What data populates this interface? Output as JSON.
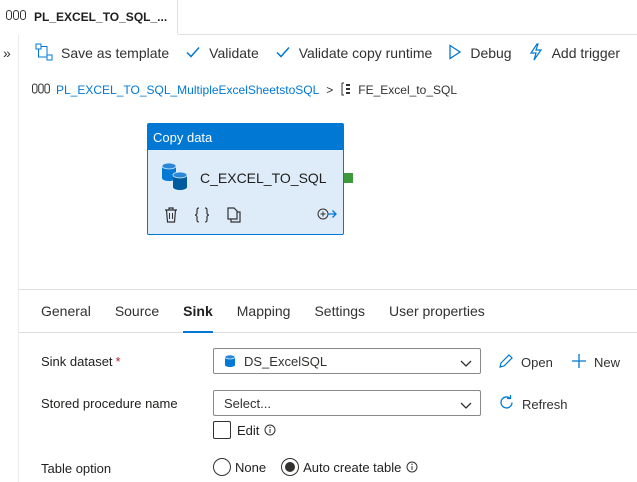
{
  "tab": {
    "label": "PL_EXCEL_TO_SQL_..."
  },
  "toolbar": {
    "save_template": "Save as template",
    "validate": "Validate",
    "validate_copy_runtime": "Validate copy runtime",
    "debug": "Debug",
    "add_trigger": "Add trigger"
  },
  "breadcrumb": {
    "pipeline": "PL_EXCEL_TO_SQL_MultipleExcelSheetstoSQL",
    "separator": ">",
    "current": "FE_Excel_to_SQL"
  },
  "activity": {
    "type": "Copy data",
    "name": "C_EXCEL_TO_SQL"
  },
  "tabs": [
    {
      "label": "General"
    },
    {
      "label": "Source"
    },
    {
      "label": "Sink"
    },
    {
      "label": "Mapping"
    },
    {
      "label": "Settings"
    },
    {
      "label": "User properties"
    }
  ],
  "sink": {
    "dataset_label": "Sink dataset",
    "required_mark": "*",
    "dataset_value": "DS_ExcelSQL",
    "open_label": "Open",
    "new_label": "New",
    "sp_label": "Stored procedure name",
    "sp_placeholder": "Select...",
    "refresh_label": "Refresh",
    "edit_label": "Edit",
    "table_option_label": "Table option",
    "option_none": "None",
    "option_auto": "Auto create table",
    "selected_option": "Auto create table"
  },
  "colors": {
    "accent": "#0078d4",
    "activity_bg": "#deecf9",
    "success_port": "#3c9a3c"
  }
}
